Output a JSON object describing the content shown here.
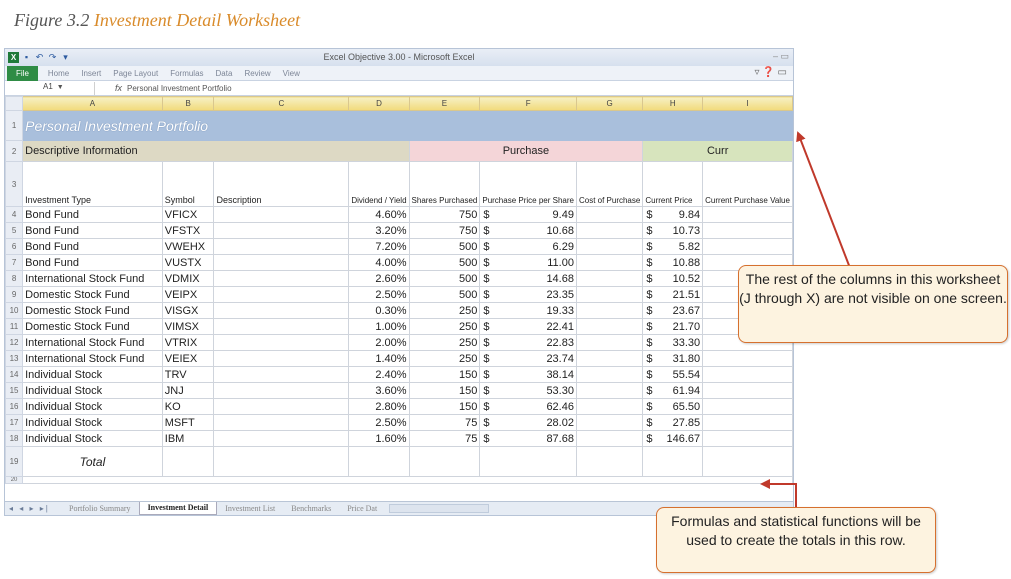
{
  "caption": {
    "prefix": "Figure 3.2 ",
    "title": "Investment Detail Worksheet"
  },
  "window": {
    "title": "Excel Objective 3.00 - Microsoft Excel",
    "controls": "– ▭",
    "quick_access": [
      "↶",
      "↷",
      "▾"
    ]
  },
  "ribbon": {
    "file_tab": "File",
    "tabs": [
      "Home",
      "Insert",
      "Page Layout",
      "Formulas",
      "Data",
      "Review",
      "View"
    ]
  },
  "formula_bar": {
    "cell_ref": "A1",
    "fx": "fx",
    "content": "Personal Investment Portfolio"
  },
  "columns": [
    "A",
    "B",
    "C",
    "D",
    "E",
    "F",
    "G",
    "H",
    "I"
  ],
  "sheet": {
    "title": "Personal Investment Portfolio",
    "sections": {
      "descriptive": "Descriptive Information",
      "purchase": "Purchase",
      "current": "Curr"
    },
    "headers": {
      "investment_type": "Investment Type",
      "symbol": "Symbol",
      "description": "Description",
      "dividend_yield": "Dividend / Yield",
      "shares_purchased": "Shares Purchased",
      "purchase_price_per_share": "Purchase Price per Share",
      "cost_of_purchase": "Cost of Purchase",
      "current_price": "Current Price",
      "current_purchase_value": "Current Purchase Value"
    },
    "rows": [
      {
        "n": "4",
        "type": "Bond Fund",
        "symbol": "VFICX",
        "yield": "4.60%",
        "shares": "750",
        "price": "9.49",
        "current": "9.84"
      },
      {
        "n": "5",
        "type": "Bond Fund",
        "symbol": "VFSTX",
        "yield": "3.20%",
        "shares": "750",
        "price": "10.68",
        "current": "10.73"
      },
      {
        "n": "6",
        "type": "Bond Fund",
        "symbol": "VWEHX",
        "yield": "7.20%",
        "shares": "500",
        "price": "6.29",
        "current": "5.82"
      },
      {
        "n": "7",
        "type": "Bond Fund",
        "symbol": "VUSTX",
        "yield": "4.00%",
        "shares": "500",
        "price": "11.00",
        "current": "10.88"
      },
      {
        "n": "8",
        "type": "International Stock Fund",
        "symbol": "VDMIX",
        "yield": "2.60%",
        "shares": "500",
        "price": "14.68",
        "current": "10.52"
      },
      {
        "n": "9",
        "type": "Domestic Stock Fund",
        "symbol": "VEIPX",
        "yield": "2.50%",
        "shares": "500",
        "price": "23.35",
        "current": "21.51"
      },
      {
        "n": "10",
        "type": "Domestic Stock Fund",
        "symbol": "VISGX",
        "yield": "0.30%",
        "shares": "250",
        "price": "19.33",
        "current": "23.67"
      },
      {
        "n": "11",
        "type": "Domestic Stock Fund",
        "symbol": "VIMSX",
        "yield": "1.00%",
        "shares": "250",
        "price": "22.41",
        "current": "21.70"
      },
      {
        "n": "12",
        "type": "International Stock Fund",
        "symbol": "VTRIX",
        "yield": "2.00%",
        "shares": "250",
        "price": "22.83",
        "current": "33.30"
      },
      {
        "n": "13",
        "type": "International Stock Fund",
        "symbol": "VEIEX",
        "yield": "1.40%",
        "shares": "250",
        "price": "23.74",
        "current": "31.80"
      },
      {
        "n": "14",
        "type": "Individual Stock",
        "symbol": "TRV",
        "yield": "2.40%",
        "shares": "150",
        "price": "38.14",
        "current": "55.54"
      },
      {
        "n": "15",
        "type": "Individual Stock",
        "symbol": "JNJ",
        "yield": "3.60%",
        "shares": "150",
        "price": "53.30",
        "current": "61.94"
      },
      {
        "n": "16",
        "type": "Individual Stock",
        "symbol": "KO",
        "yield": "2.80%",
        "shares": "150",
        "price": "62.46",
        "current": "65.50"
      },
      {
        "n": "17",
        "type": "Individual Stock",
        "symbol": "MSFT",
        "yield": "2.50%",
        "shares": "75",
        "price": "28.02",
        "current": "27.85"
      },
      {
        "n": "18",
        "type": "Individual Stock",
        "symbol": "IBM",
        "yield": "1.60%",
        "shares": "75",
        "price": "87.68",
        "current": "146.67"
      }
    ],
    "total_label": "Total",
    "row_labels": {
      "r1": "1",
      "r2": "2",
      "r3": "3",
      "rtot": "19",
      "r20": "20"
    },
    "currency_symbol": "$"
  },
  "sheet_tabs": {
    "nav": "◂ ◂ ▸ ▸|",
    "tabs": [
      "Portfolio Summary",
      "Investment Detail",
      "Investment List",
      "Benchmarks",
      "Price Dat"
    ],
    "active_index": 1
  },
  "callouts": {
    "columns_note": "The rest of the columns in this worksheet (J through X) are not visible on one screen.",
    "totals_note": "Formulas and statistical functions will be used to create the totals in this row."
  },
  "colors": {
    "accent": "#d98b2b",
    "callout_border": "#d6702e",
    "arrow": "#c0392b",
    "title_band": "#a9bfdc",
    "file_tab": "#2f8c45"
  }
}
